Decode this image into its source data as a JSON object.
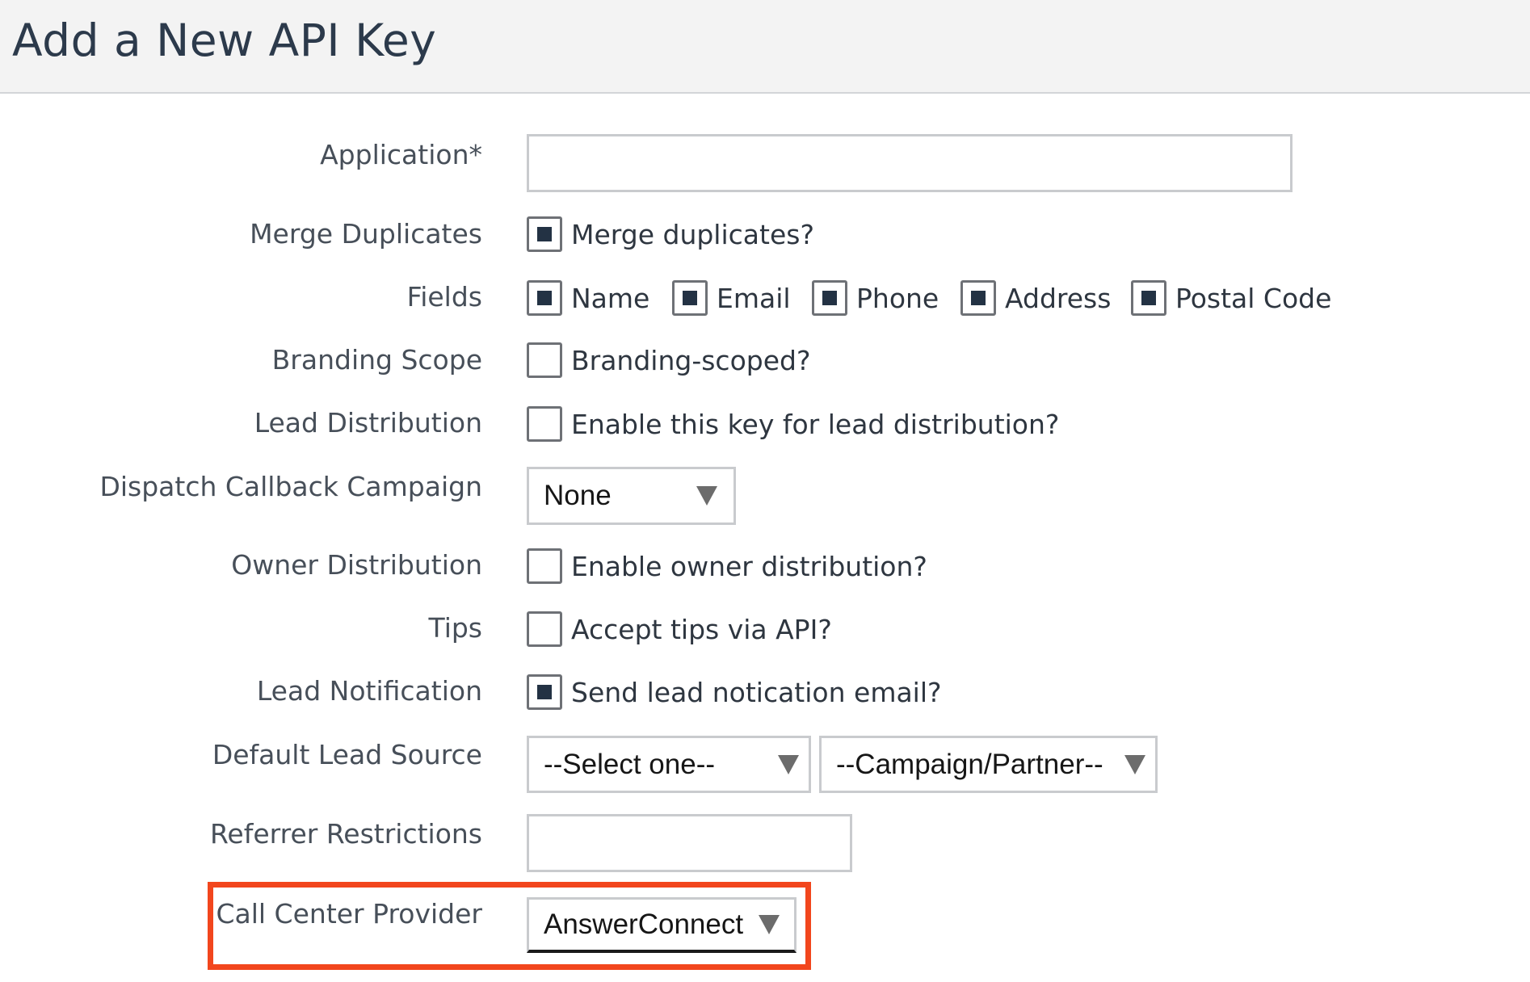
{
  "page": {
    "title": "Add a New API Key"
  },
  "form": {
    "application": {
      "label": "Application*",
      "value": ""
    },
    "merge_duplicates": {
      "label": "Merge Duplicates",
      "checkbox_label": "Merge duplicates?",
      "checked": true
    },
    "fields": {
      "label": "Fields",
      "options": [
        {
          "label": "Name",
          "checked": true
        },
        {
          "label": "Email",
          "checked": true
        },
        {
          "label": "Phone",
          "checked": true
        },
        {
          "label": "Address",
          "checked": true
        },
        {
          "label": "Postal Code",
          "checked": true
        }
      ]
    },
    "branding_scope": {
      "label": "Branding Scope",
      "checkbox_label": "Branding-scoped?",
      "checked": false
    },
    "lead_distribution": {
      "label": "Lead Distribution",
      "checkbox_label": "Enable this key for lead distribution?",
      "checked": false
    },
    "dispatch_callback": {
      "label": "Dispatch Callback Campaign",
      "selected": "None"
    },
    "owner_distribution": {
      "label": "Owner Distribution",
      "checkbox_label": "Enable owner distribution?",
      "checked": false
    },
    "tips": {
      "label": "Tips",
      "checkbox_label": "Accept tips via API?",
      "checked": false
    },
    "lead_notification": {
      "label": "Lead Notification",
      "checkbox_label": "Send lead notication email?",
      "checked": true
    },
    "default_lead_source": {
      "label": "Default Lead Source",
      "source_selected": "--Select one--",
      "campaign_selected": "--Campaign/Partner--"
    },
    "referrer_restrictions": {
      "label": "Referrer Restrictions",
      "value": ""
    },
    "call_center_provider": {
      "label": "Call Center Provider",
      "selected": "AnswerConnect"
    }
  },
  "colors": {
    "highlight": "#f2461d",
    "checkbox_fill": "#233244",
    "header_bg": "#f3f3f3"
  }
}
